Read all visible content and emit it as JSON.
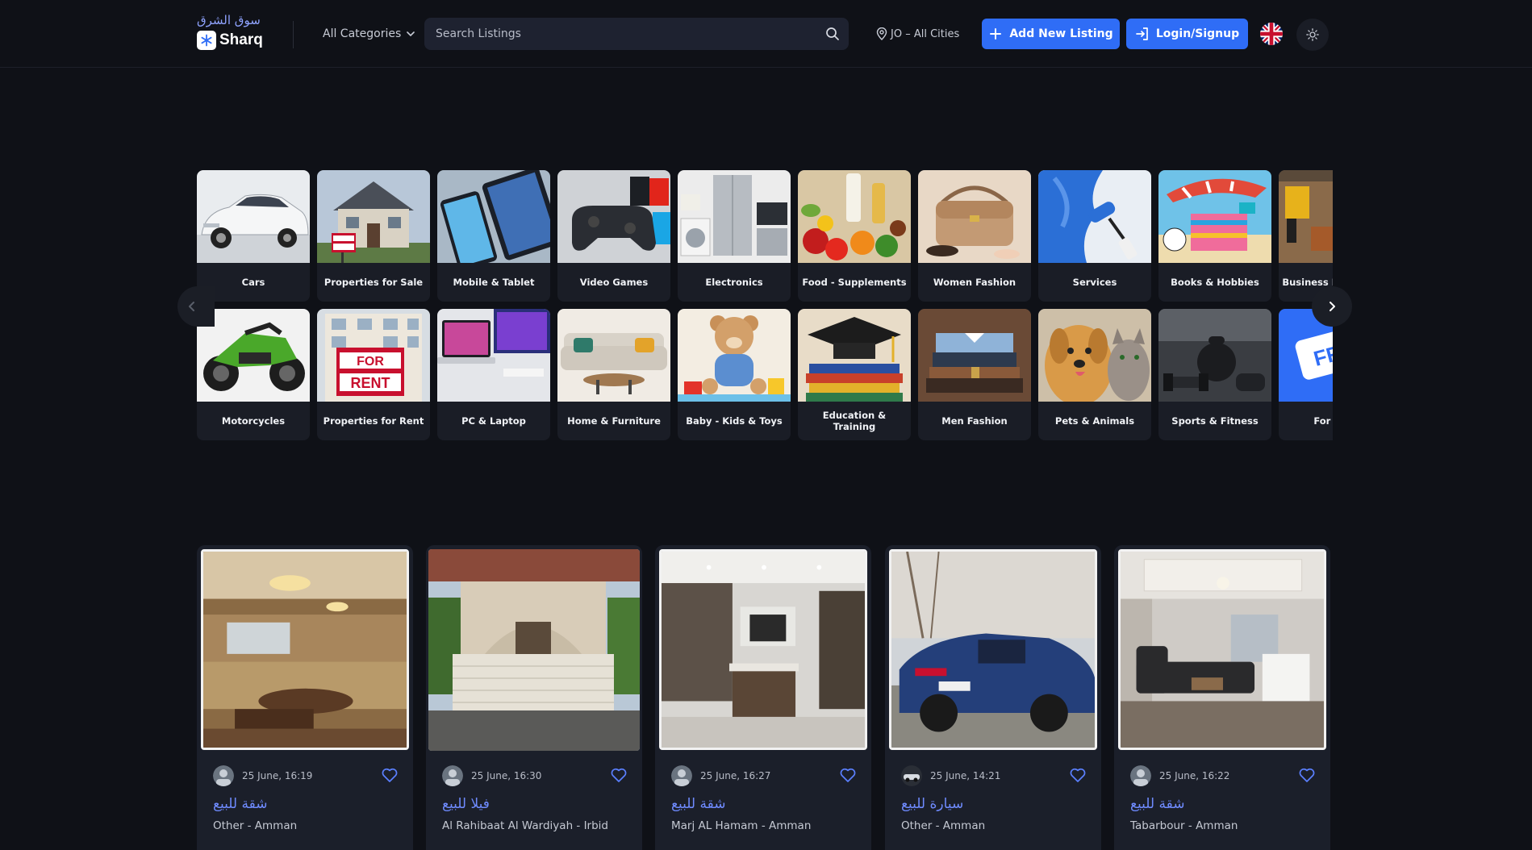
{
  "header": {
    "logo_ar": "سوق الشرق",
    "logo_en": "Sharq",
    "categories_label": "All Categories",
    "search_placeholder": "Search Listings",
    "location": "JO – All Cities",
    "add_listing_label": "Add New Listing",
    "login_label": "Login/Signup",
    "language_flag": "uk-flag-icon",
    "theme_icon": "sun-icon",
    "accent_color": "#2f6df6"
  },
  "categories_row1": [
    {
      "label": "Cars",
      "icon": "car-image"
    },
    {
      "label": "Properties for Sale",
      "icon": "house-image"
    },
    {
      "label": "Mobile & Tablet",
      "icon": "phone-image"
    },
    {
      "label": "Video Games",
      "icon": "gamepad-image"
    },
    {
      "label": "Electronics",
      "icon": "appliances-image"
    },
    {
      "label": "Food - Supplements",
      "icon": "food-image"
    },
    {
      "label": "Women Fashion",
      "icon": "handbag-image"
    },
    {
      "label": "Services",
      "icon": "paint-roller-image"
    },
    {
      "label": "Books & Hobbies",
      "icon": "beach-image"
    },
    {
      "label": "Business Equipment",
      "icon": "tools-image"
    }
  ],
  "categories_row2": [
    {
      "label": "Motorcycles",
      "icon": "motorcycle-image"
    },
    {
      "label": "Properties for Rent",
      "icon": "rent-building-image"
    },
    {
      "label": "PC & Laptop",
      "icon": "laptop-image"
    },
    {
      "label": "Home & Furniture",
      "icon": "sofa-image"
    },
    {
      "label": "Baby - Kids & Toys",
      "icon": "teddy-image"
    },
    {
      "label": "Education & Training",
      "icon": "graduation-image"
    },
    {
      "label": "Men Fashion",
      "icon": "shirts-image"
    },
    {
      "label": "Pets & Animals",
      "icon": "dog-cat-image"
    },
    {
      "label": "Sports & Fitness",
      "icon": "dumbbell-image"
    },
    {
      "label": "For Free",
      "icon": "free-tag-image"
    }
  ],
  "listings": [
    {
      "date": "25 June, 16:19",
      "title": "شقة للبيع",
      "location": "Other - Amman"
    },
    {
      "date": "25 June, 16:30",
      "title": "فيلا للبيع",
      "location": "Al Rahibaat Al Wardiyah - Irbid"
    },
    {
      "date": "25 June, 16:27",
      "title": "شقة للبيع",
      "location": "Marj AL Hamam - Amman"
    },
    {
      "date": "25 June, 14:21",
      "title": "سيارة للبيع",
      "location": "Other - Amman"
    },
    {
      "date": "25 June, 16:22",
      "title": "شقة للبيع",
      "location": "Tabarbour - Amman"
    }
  ]
}
